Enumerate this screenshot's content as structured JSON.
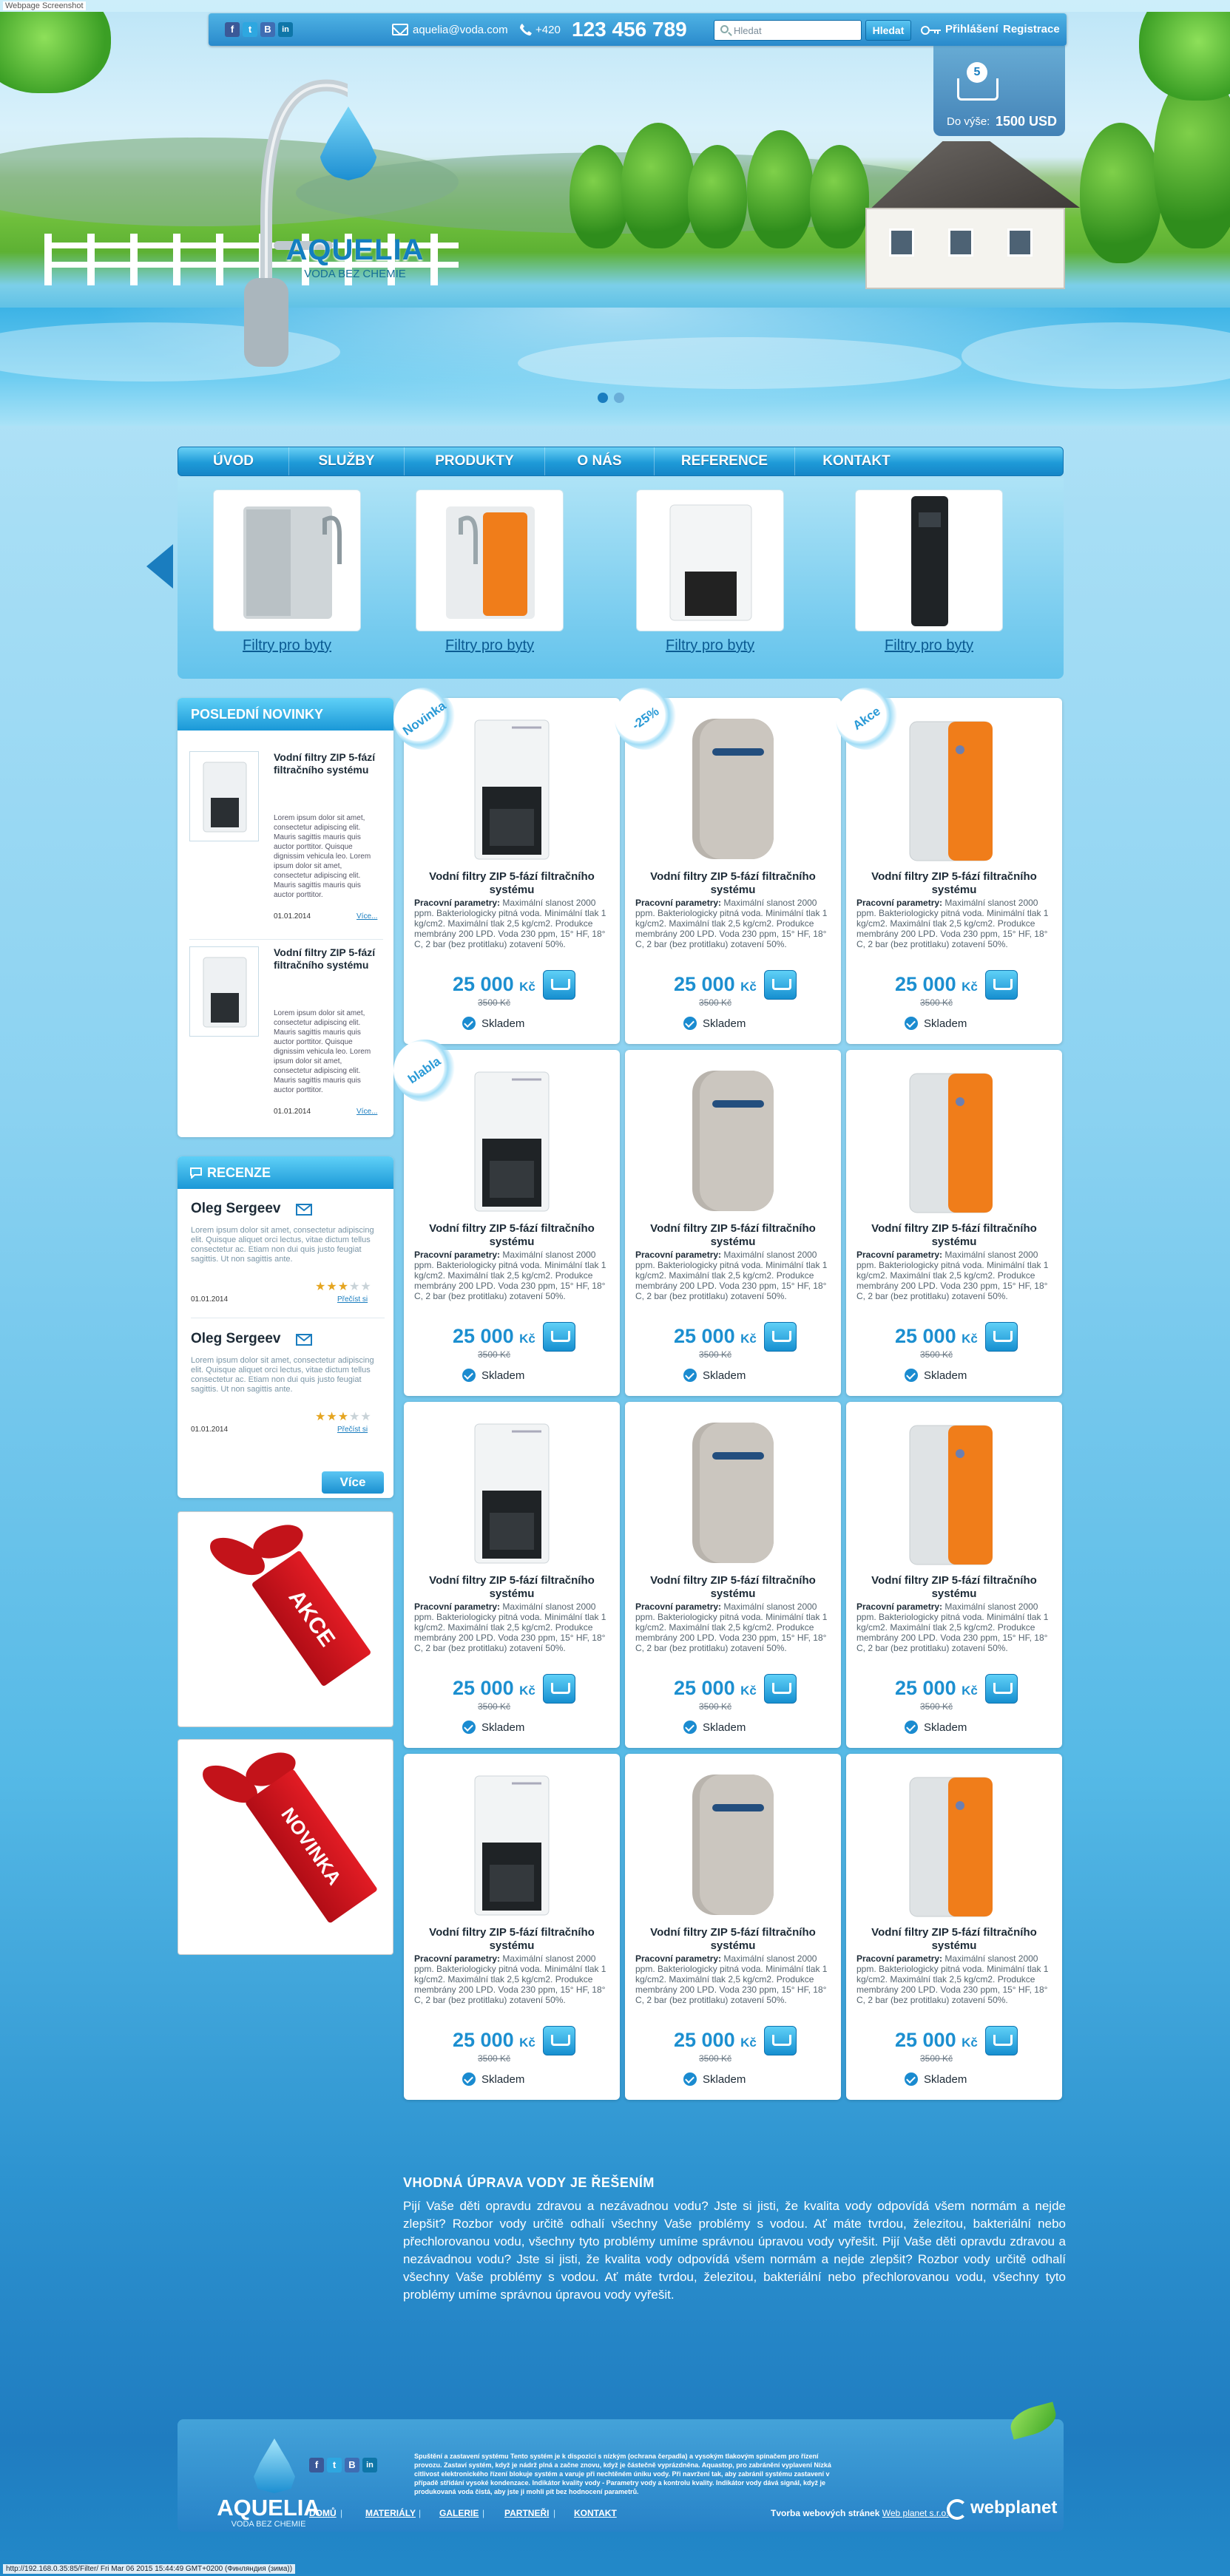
{
  "page_title_label": "Webpage Screenshot",
  "topbar": {
    "social": [
      "f",
      "t",
      "B",
      "in"
    ],
    "email": "aquelia@voda.com",
    "phone_prefix": "+420",
    "phone": "123 456 789",
    "search_placeholder": "Hledat",
    "search_button": "Hledat",
    "login": "Přihlášení",
    "register": "Registrace"
  },
  "cart": {
    "count": "5",
    "label": "Do výše:",
    "amount": "1500 USD"
  },
  "logo": {
    "name": "AQUELIA",
    "tagline": "VODA BEZ CHEMIE"
  },
  "nav": [
    "ÚVOD",
    "SLUŽBY",
    "PRODUKTY",
    "O NÁS",
    "REFERENCE",
    "KONTAKT"
  ],
  "carousel": [
    "Filtry pro byty",
    "Filtry pro byty",
    "Filtry pro byty",
    "Filtry pro byty"
  ],
  "sidebar": {
    "news_title": "POSLEDNÍ NOVINKY",
    "news": [
      {
        "title": "Vodní filtry ZIP 5-fází filtračního systému",
        "text": "Lorem ipsum dolor sit amet, consectetur adipiscing elit. Mauris sagittis mauris quis auctor porttitor. Quisque dignissim vehicula leo. Lorem ipsum dolor sit amet, consectetur adipiscing elit. Mauris sagittis mauris quis auctor porttitor.",
        "date": "01.01.2014",
        "more": "Více..."
      },
      {
        "title": "Vodní filtry ZIP 5-fází filtračního systému",
        "text": "Lorem ipsum dolor sit amet, consectetur adipiscing elit. Mauris sagittis mauris quis auctor porttitor. Quisque dignissim vehicula leo. Lorem ipsum dolor sit amet, consectetur adipiscing elit. Mauris sagittis mauris quis auctor porttitor.",
        "date": "01.01.2014",
        "more": "Více..."
      }
    ],
    "reviews_title": "RECENZE",
    "reviews": [
      {
        "name": "Oleg Sergeev",
        "text": "Lorem ipsum dolor sit amet, consectetur adipiscing elit. Quisque aliquet orci lectus, vitae dictum tellus consectetur ac. Etiam non dui quis justo feugiat sagittis. Ut non sagittis ante.",
        "date": "01.01.2014",
        "link": "Přečíst si",
        "rating": 3
      },
      {
        "name": "Oleg Sergeev",
        "text": "Lorem ipsum dolor sit amet, consectetur adipiscing elit. Quisque aliquet orci lectus, vitae dictum tellus consectetur ac. Etiam non dui quis justo feugiat sagittis. Ut non sagittis ante.",
        "date": "01.01.2014",
        "link": "Přečíst si",
        "rating": 3
      }
    ],
    "reviews_button": "Více",
    "promo1": "AKCE",
    "promo2": "NOVINKA"
  },
  "product": {
    "title": "Vodní filtry ZIP 5-fází filtračního systému",
    "params_label": "Pracovní parametry:",
    "params": "Maximální slanost 2000 ppm. Bakteriologicky pitná voda. Minimální tlak 1 kg/cm2. Maximální tlak 2,5 kg/cm2. Produkce membrány 200 LPD. Voda 230 ppm, 15° HF, 18° C, 2 bar (bez protitlaku) zotavení 50%.",
    "price": "25 000",
    "currency": "Kč",
    "old_price": "3500 Kč",
    "stock": "Skladem"
  },
  "stickers": {
    "0": "Novinka",
    "1": "-25%",
    "2": "Akce",
    "3": "blabla"
  },
  "about": {
    "title": "VHODNÁ ÚPRAVA VODY JE ŘEŠENÍM",
    "text": "Pijí Vaše děti opravdu zdravou a nezávadnou vodu? Jste si jisti, že kvalita vody odpovídá všem normám a nejde zlepšit? Rozbor vody určitě odhalí všechny Vaše problémy s vodou. Ať máte tvrdou, železitou, bakteriální nebo přechlorovanou vodu, všechny tyto problémy umíme správnou úpravou vody vyřešit. Pijí Vaše děti opravdu zdravou a nezávadnou vodu? Jste si jisti, že kvalita vody odpovídá všem normám a nejde zlepšit? Rozbor vody určitě odhalí všechny Vaše problémy s vodou. Ať máte tvrdou, železitou, bakteriální nebo přechlorovanou vodu, všechny tyto problémy umíme správnou úpravou vody vyřešit."
  },
  "footer": {
    "text": "Spuštění a zastavení systému Tento systém je k dispozici s nízkým (ochrana čerpadla) a vysokým tlakovým spínačem pro řízení provozu. Zastaví systém, když je nádrž plná a začne znovu, když je částečně vyprázdněna. Aquastop, pro zabránění vyplavení Nízká citlivost elektronického řízení blokuje systém a varuje při nechtěném úniku vody. Při navržení tak, aby zabránil systému zastavení v případě střídání vysoké kondenzace. Indikátor kvality vody - Parametry vody a kontrolu kvality. Indikátor vody dává signál, když je produkovaná voda čistá, aby jste ji mohli pít bez hodnocení parametrů.",
    "menu": [
      "DOMŮ",
      "MATERIÁLY",
      "GALERIE",
      "PARTNEŘI",
      "KONTAKT"
    ],
    "credit_prefix": "Tvorba webových stránek",
    "credit_link": "Web planet s.r.o.",
    "brand": "webplanet"
  },
  "status_bar": "http://192.168.0.35:85/Filter/  Fri Mar 06 2015 15:44:49 GMT+0200 (Финляндия (зима))"
}
